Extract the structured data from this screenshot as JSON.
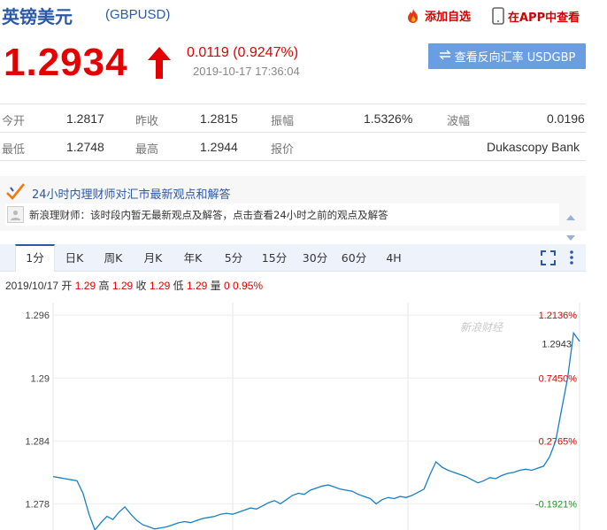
{
  "header": {
    "title": "英镑美元",
    "code": "(GBPUSD)",
    "add_watch": "添加自选",
    "view_app": "在APP中查看"
  },
  "quote": {
    "price": "1.2934",
    "change": "0.0119 (0.9247%)",
    "time": "2019-10-17 17:36:04",
    "reverse_label": "查看反向汇率 USDGBP",
    "up_color": "#e40000"
  },
  "stats": {
    "open_label": "今开",
    "open": "1.2817",
    "prev_close_label": "昨收",
    "prev_close": "1.2815",
    "amplitude_label": "振幅",
    "amplitude": "1.5326%",
    "volatility_label": "波幅",
    "volatility": "0.0196",
    "low_label": "最低",
    "low": "1.2748",
    "high_label": "最高",
    "high": "1.2944",
    "quote_src_label": "报价",
    "quote_src": "Dukascopy Bank"
  },
  "expert": {
    "title": "24小时内理财师对汇市最新观点和解答",
    "message": "新浪理财师：该时段内暂无最新观点及解答，点击查看24小时之前的观点及解答"
  },
  "tabs": [
    "1分",
    "日K",
    "周K",
    "月K",
    "年K",
    "5分",
    "15分",
    "30分",
    "60分",
    "4H"
  ],
  "ohlc": {
    "date": "2019/10/17",
    "open_label": "开",
    "open": "1.29",
    "high_label": "高",
    "high": "1.29",
    "close_label": "收",
    "close": "1.29",
    "low_label": "低",
    "low": "1.29",
    "vol_label": "量",
    "vol": "0",
    "pct": "0.95%"
  },
  "chart_data": {
    "type": "line",
    "y_ticks": [
      "1.296",
      "1.29",
      "1.284",
      "1.278"
    ],
    "y_tick_values": [
      1.296,
      1.29,
      1.284,
      1.278
    ],
    "pct_ticks": [
      "1.2136%",
      "0.7450%",
      "0.2765%",
      "-0.1921%"
    ],
    "last_value_label": "1.2943",
    "ylim": [
      1.2755,
      1.2972
    ],
    "watermark": "新浪财经",
    "line_color": "#1a7fc1",
    "values": [
      1.2806,
      1.2805,
      1.2804,
      1.2803,
      1.2802,
      1.279,
      1.277,
      1.2755,
      1.2762,
      1.2768,
      1.2765,
      1.2772,
      1.2777,
      1.277,
      1.2764,
      1.276,
      1.2758,
      1.2756,
      1.2757,
      1.2758,
      1.276,
      1.2762,
      1.2763,
      1.2762,
      1.2764,
      1.2766,
      1.2767,
      1.2768,
      1.277,
      1.2771,
      1.277,
      1.2772,
      1.2774,
      1.2776,
      1.2775,
      1.2778,
      1.2781,
      1.2783,
      1.278,
      1.2784,
      1.2788,
      1.279,
      1.2789,
      1.2793,
      1.2795,
      1.2797,
      1.2798,
      1.2796,
      1.2794,
      1.2793,
      1.2792,
      1.2789,
      1.2787,
      1.2785,
      1.278,
      1.2784,
      1.2786,
      1.2785,
      1.2787,
      1.2786,
      1.2788,
      1.2791,
      1.2794,
      1.2808,
      1.282,
      1.2815,
      1.2812,
      1.281,
      1.2808,
      1.2806,
      1.2803,
      1.28,
      1.2802,
      1.2805,
      1.2804,
      1.2807,
      1.2809,
      1.281,
      1.2812,
      1.2813,
      1.2812,
      1.2814,
      1.2816,
      1.2825,
      1.284,
      1.287,
      1.29,
      1.2943,
      1.2935
    ]
  }
}
